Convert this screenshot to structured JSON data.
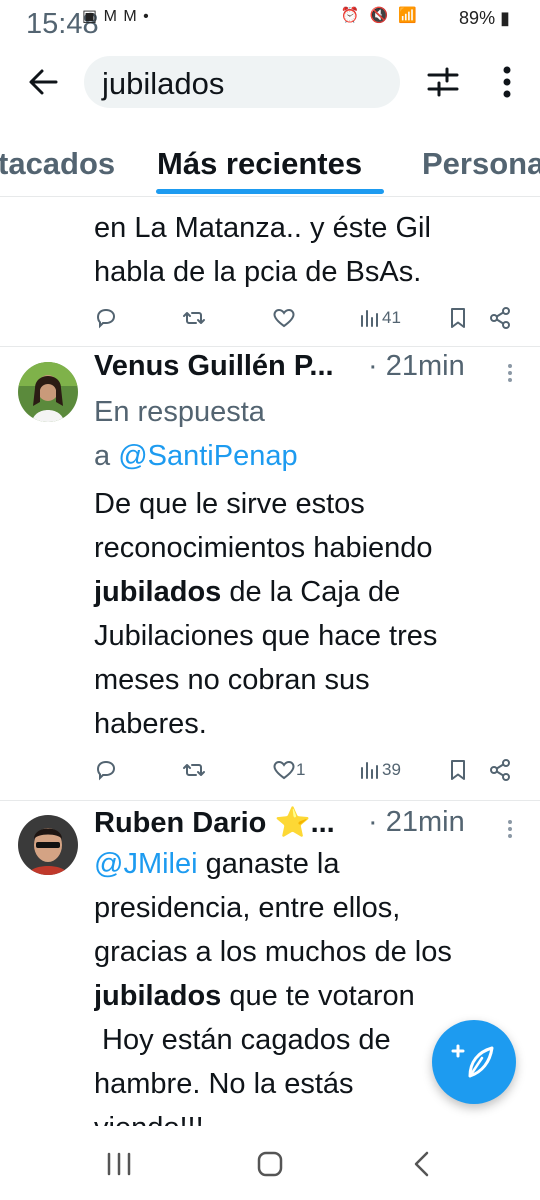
{
  "status_bar": {
    "time": "15:48",
    "left_icons": "▣ M M •",
    "right_icons": "⏰ 🔇 📶",
    "battery": "89%"
  },
  "header": {
    "search_query": "jubilados"
  },
  "tabs": [
    {
      "label": "Destacados",
      "visible_text": "tacados",
      "active": false
    },
    {
      "label": "Más recientes",
      "active": true
    },
    {
      "label": "Personas",
      "visible_text": "Persona",
      "active": false
    }
  ],
  "tweets": [
    {
      "partial": true,
      "text_lines": [
        "en La Matanza.. y éste Gil",
        "habla de la pcia de BsAs."
      ],
      "actions": {
        "replies": "",
        "retweets": "",
        "likes": "",
        "views": "41"
      }
    },
    {
      "author": "Venus Guillén P...",
      "time": "· 21min",
      "reply_prefix": "En respuesta",
      "reply_to_a": "a ",
      "reply_handle": "@SantiPenap",
      "body": {
        "line1": "De que le sirve estos",
        "line2": "reconocimientos habiendo",
        "line3_bold": "jubilados",
        "line3_rest": " de la Caja de",
        "line4": "Jubilaciones que  hace tres",
        "line5": "meses no cobran sus",
        "line6": "haberes."
      },
      "actions": {
        "replies": "",
        "retweets": "",
        "likes": "1",
        "views": "39"
      }
    },
    {
      "author": "Ruben Dario ⭐...",
      "time": "· 21min",
      "body": {
        "line1_handle": "@JMilei",
        "line1_rest": " ganaste la",
        "line2": "presidencia, entre ellos,",
        "line3": "gracias a los muchos de los",
        "line4_bold": "jubilados",
        "line4_rest": " que te votaron",
        "line5": " Hoy están cagados de",
        "line6": "hambre. No la estás",
        "line7": "viendo!!!"
      }
    }
  ],
  "colors": {
    "accent": "#1d9bf0",
    "text": "#0f1419",
    "muted": "#536471"
  }
}
